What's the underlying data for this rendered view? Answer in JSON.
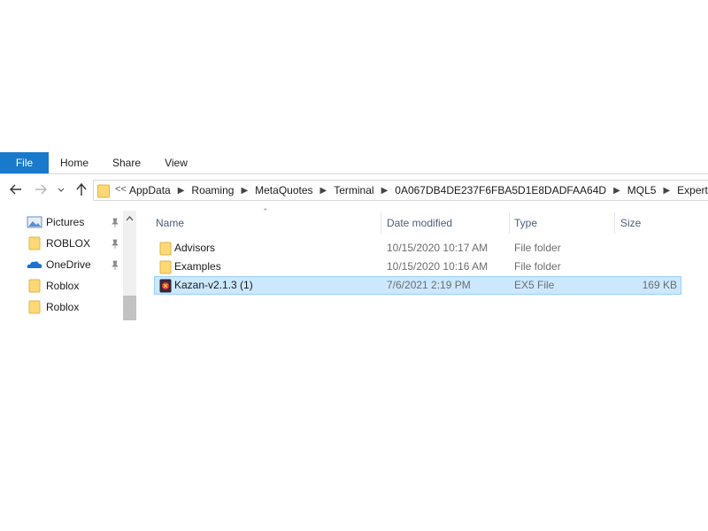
{
  "ribbon": {
    "tabs": [
      {
        "label": "File",
        "active": true
      },
      {
        "label": "Home"
      },
      {
        "label": "Share"
      },
      {
        "label": "View"
      }
    ],
    "accent": "#1979ca"
  },
  "nav": {
    "overflow_marker": "<<",
    "breadcrumb": [
      "AppData",
      "Roaming",
      "MetaQuotes",
      "Terminal",
      "0A067DB4DE237F6FBA5D1E8DADFAA64D",
      "MQL5",
      "Experts"
    ]
  },
  "sidebar": {
    "items": [
      {
        "label": "Pictures",
        "icon": "pictures-icon",
        "pinned": true
      },
      {
        "label": "ROBLOX",
        "icon": "folder-icon",
        "pinned": true
      },
      {
        "label": "OneDrive",
        "icon": "onedrive-icon",
        "pinned": true
      },
      {
        "label": "Roblox",
        "icon": "folder-icon",
        "pinned": false
      },
      {
        "label": "Roblox",
        "icon": "folder-icon",
        "pinned": false
      }
    ]
  },
  "filelist": {
    "columns": [
      "Name",
      "Date modified",
      "Type",
      "Size"
    ],
    "rows": [
      {
        "name": "Advisors",
        "date": "10/15/2020 10:17 AM",
        "type": "File folder",
        "size": "",
        "icon": "folder-icon",
        "selected": false
      },
      {
        "name": "Examples",
        "date": "10/15/2020 10:16 AM",
        "type": "File folder",
        "size": "",
        "icon": "folder-icon",
        "selected": false
      },
      {
        "name": "Kazan-v2.1.3 (1)",
        "date": "7/6/2021 2:19 PM",
        "type": "EX5 File",
        "size": "169 KB",
        "icon": "ex5-file-icon",
        "selected": true
      }
    ],
    "selection_color": "#cce8ff"
  }
}
